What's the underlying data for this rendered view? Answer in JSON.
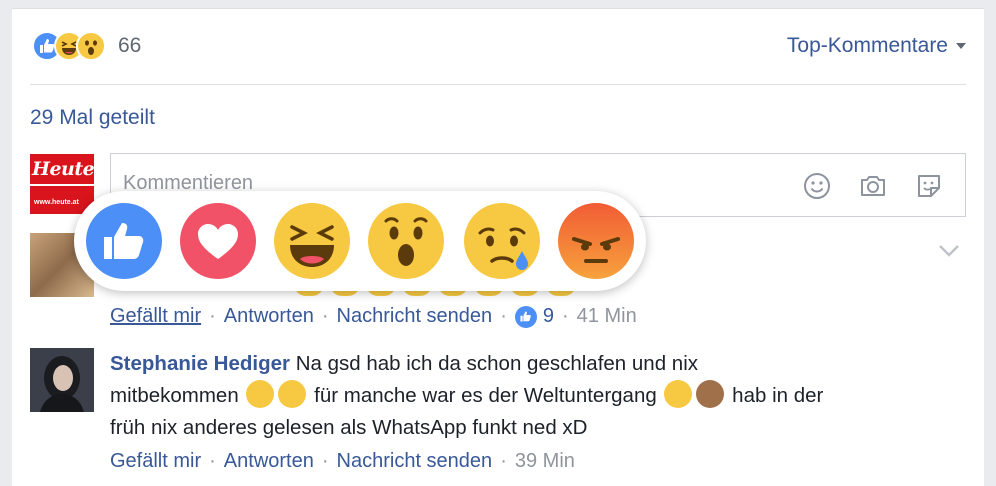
{
  "reactions_summary": {
    "icons": [
      "like-icon",
      "haha-icon",
      "wow-icon"
    ],
    "count": "66",
    "sort_label": "Top-Kommentare"
  },
  "shares": {
    "label": "29 Mal geteilt"
  },
  "composer": {
    "page_logo_text": "Heute",
    "page_logo_url": "www.heute.at",
    "placeholder": "Kommentieren",
    "icons": [
      "emoji-icon",
      "camera-icon",
      "sticker-icon"
    ]
  },
  "reaction_picker": {
    "options": [
      "like",
      "love",
      "haha",
      "wow",
      "sad",
      "angry"
    ]
  },
  "comments": [
    {
      "actions": {
        "like": "Gefällt mir",
        "reply": "Antworten",
        "message": "Nachricht senden",
        "like_count": "9",
        "time": "41 Min"
      }
    },
    {
      "author": "Stephanie Hediger",
      "text_1": "Na gsd hab ich da schon geschlafen und nix",
      "text_2": "mitbekommen",
      "text_3": "für manche war es der Weltuntergang",
      "text_4": "hab in der",
      "text_5": "früh nix anderes gelesen als WhatsApp funkt ned xD",
      "actions": {
        "like": "Gefällt mir",
        "reply": "Antworten",
        "message": "Nachricht senden",
        "time": "39 Min"
      }
    }
  ],
  "colors": {
    "link": "#385898",
    "meta": "#90949c",
    "like_blue": "#4c8ff7",
    "love_red": "#f25268",
    "emoji_yellow": "#f7c942"
  }
}
